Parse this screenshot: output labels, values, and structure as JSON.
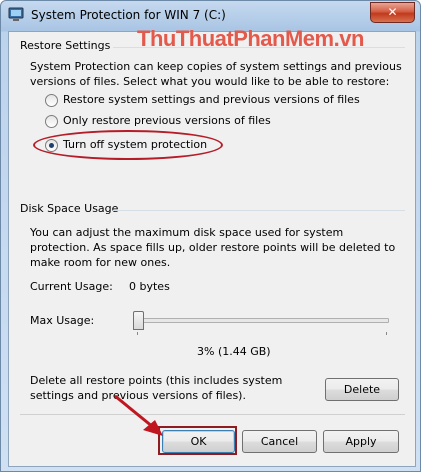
{
  "window": {
    "title": "System Protection for WIN 7 (C:)",
    "close_label": "✕"
  },
  "watermark": "ThuThuatPhanMem.vn",
  "restore_settings": {
    "label": "Restore Settings",
    "description": "System Protection can keep copies of system settings and previous versions of files. Select what you would like to be able to restore:",
    "options": [
      {
        "label": "Restore system settings and previous versions of files",
        "checked": false
      },
      {
        "label": "Only restore previous versions of files",
        "checked": false
      },
      {
        "label": "Turn off system protection",
        "checked": true
      }
    ]
  },
  "disk_space": {
    "label": "Disk Space Usage",
    "description": "You can adjust the maximum disk space used for system protection. As space fills up, older restore points will be deleted to make room for new ones.",
    "current_usage_label": "Current Usage:",
    "current_usage_value": "0 bytes",
    "max_usage_label": "Max Usage:",
    "max_usage_fraction": 0.03,
    "max_usage_value": "3% (1.44 GB)",
    "delete_text": "Delete all restore points (this includes system settings and previous versions of files).",
    "delete_button": "Delete"
  },
  "footer": {
    "ok": "OK",
    "cancel": "Cancel",
    "apply": "Apply"
  },
  "colors": {
    "annotation_red": "#b51d28",
    "title_gradient": "#a9c5e4"
  }
}
